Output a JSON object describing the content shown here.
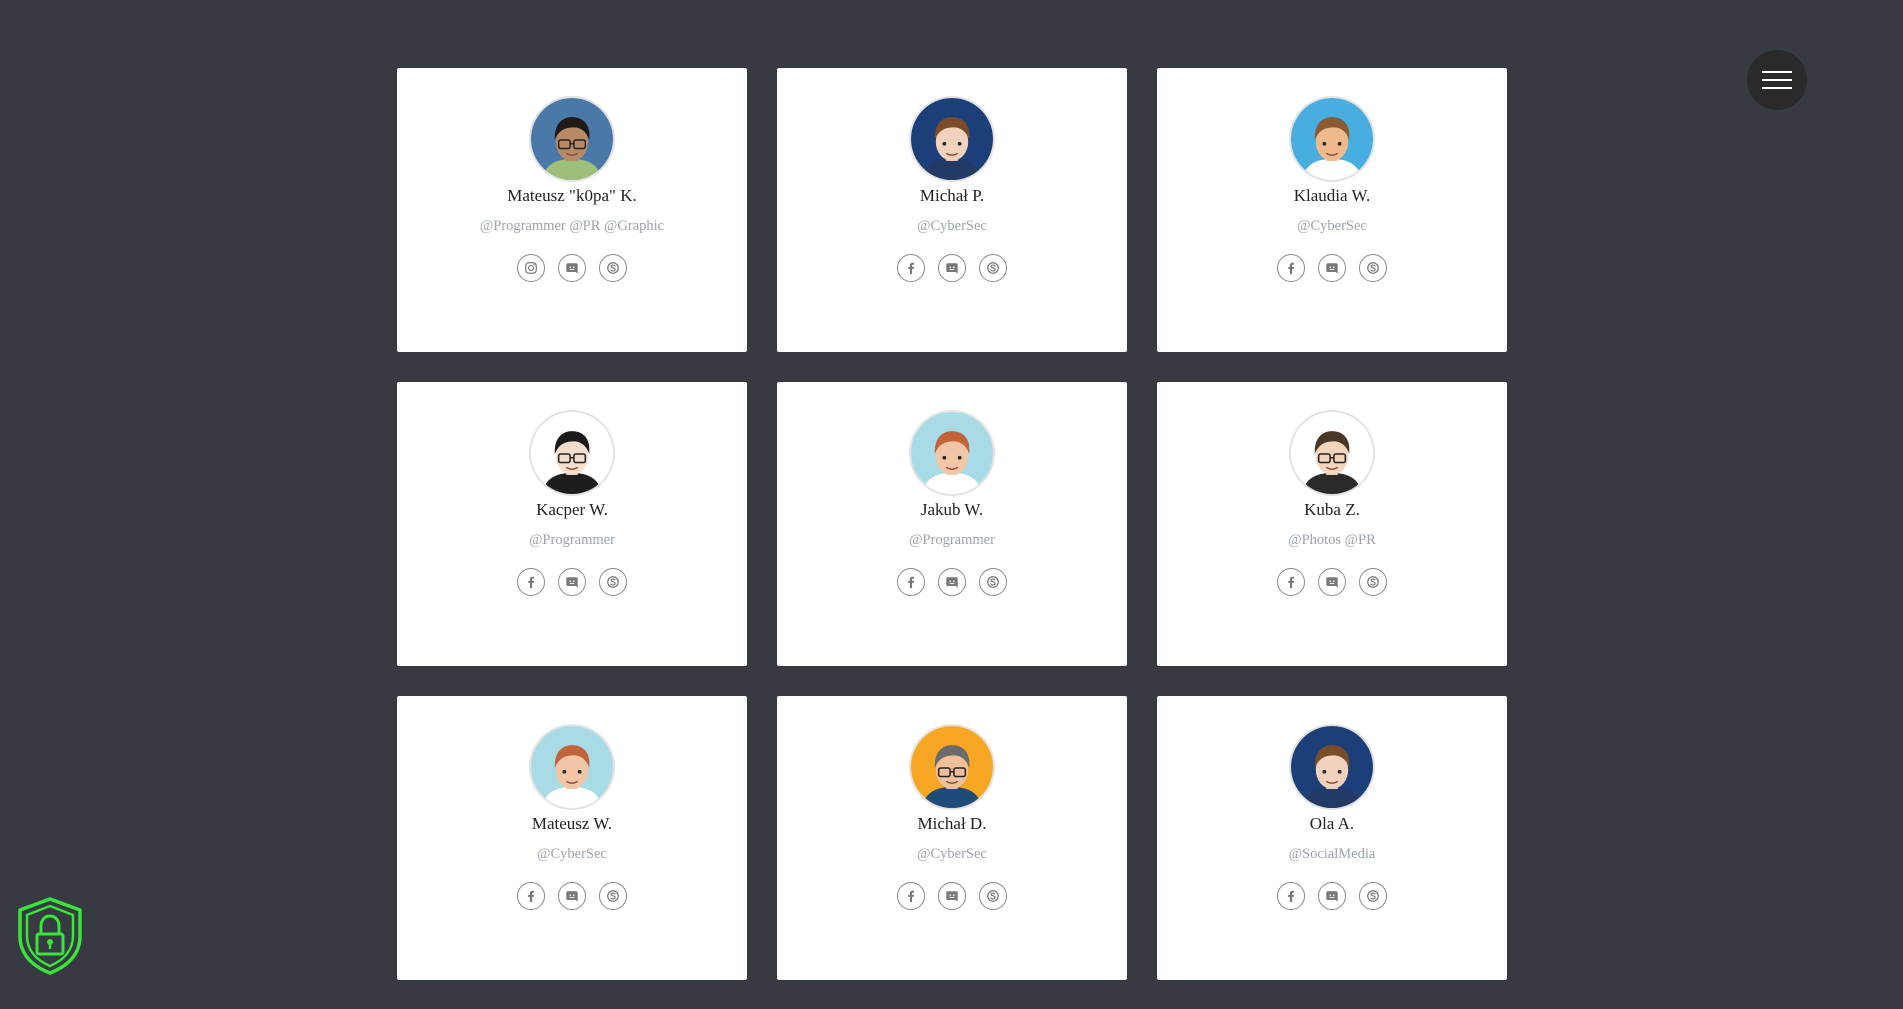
{
  "colors": {
    "background": "#373a41",
    "card": "#ffffff",
    "role_text": "#9aa4ae",
    "shield": "#39e53a"
  },
  "menu": {
    "icon": "hamburger-menu-icon"
  },
  "logo": {
    "icon": "shield-lock-icon"
  },
  "members": [
    {
      "name": "Mateusz \"k0pa\" K.",
      "role": "@Programmer @PR @Graphic",
      "avatar_bg": "#4a79a8",
      "hair": "#1e1a16",
      "skin": "#b98a68",
      "shirt": "#9cbf7a",
      "glasses": true,
      "socials": [
        "instagram",
        "discord",
        "skype"
      ]
    },
    {
      "name": "Michał P.",
      "role": "@CyberSec",
      "avatar_bg": "#1c3f7a",
      "hair": "#7a4c2a",
      "skin": "#f2d2bd",
      "shirt": "#233a66",
      "glasses": false,
      "socials": [
        "facebook",
        "discord",
        "skype"
      ]
    },
    {
      "name": "Klaudia W.",
      "role": "@CyberSec",
      "avatar_bg": "#48aee0",
      "hair": "#8a5a32",
      "skin": "#f0b98c",
      "shirt": "#ffffff",
      "glasses": false,
      "socials": [
        "facebook",
        "discord",
        "skype"
      ]
    },
    {
      "name": "Kacper W.",
      "role": "@Programmer",
      "avatar_bg": "#ffffff",
      "hair": "#1a1a1a",
      "skin": "#f3ddcc",
      "shirt": "#1d1d1d",
      "glasses": true,
      "socials": [
        "facebook",
        "discord",
        "skype"
      ]
    },
    {
      "name": "Jakub W.",
      "role": "@Programmer",
      "avatar_bg": "#a9dbe6",
      "hair": "#c2643b",
      "skin": "#f2c6a4",
      "shirt": "#ffffff",
      "glasses": false,
      "socials": [
        "facebook",
        "discord",
        "skype"
      ]
    },
    {
      "name": "Kuba Z.",
      "role": "@Photos @PR",
      "avatar_bg": "#ffffff",
      "hair": "#4a3728",
      "skin": "#f3d4bd",
      "shirt": "#2a2a2a",
      "glasses": true,
      "socials": [
        "facebook",
        "discord",
        "skype"
      ]
    },
    {
      "name": "Mateusz W.",
      "role": "@CyberSec",
      "avatar_bg": "#a9dbe6",
      "hair": "#c2643b",
      "skin": "#f2c6a4",
      "shirt": "#ffffff",
      "glasses": false,
      "socials": [
        "facebook",
        "discord",
        "skype"
      ]
    },
    {
      "name": "Michał D.",
      "role": "@CyberSec",
      "avatar_bg": "#f6a623",
      "hair": "#6b6b6b",
      "skin": "#f0c09c",
      "shirt": "#1e4b7a",
      "glasses": true,
      "socials": [
        "facebook",
        "discord",
        "skype"
      ]
    },
    {
      "name": "Ola A.",
      "role": "@SocialMedia",
      "avatar_bg": "#1c3f7a",
      "hair": "#7a4c2a",
      "skin": "#f2d2bd",
      "shirt": "#233a66",
      "glasses": false,
      "socials": [
        "facebook",
        "discord",
        "skype"
      ]
    }
  ]
}
